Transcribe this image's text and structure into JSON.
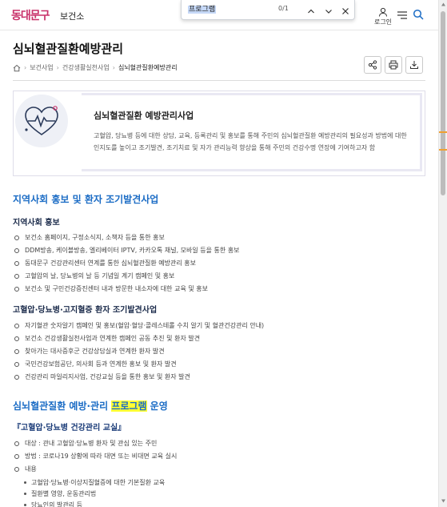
{
  "header": {
    "logo": "동대문구",
    "site_name": "보건소",
    "login_label": "로그인"
  },
  "findbar": {
    "query": "프로그램",
    "count": "0/1"
  },
  "page": {
    "title": "심뇌혈관질환예방관리",
    "breadcrumb": [
      "보건사업",
      "건강생활실천사업",
      "심뇌혈관질환예방관리"
    ]
  },
  "intro": {
    "title": "심뇌혈관질환 예방관리사업",
    "text": "고혈압, 당뇨병 등에 대한 상담, 교육, 등록관리 및 홍보를 통해 주민의 심뇌혈관질환 예방관리의 필요성과 방법에 대한 인지도를 높이고 조기발견, 조기치료 및 자가 관리능력 향상을 통해 주민의 건강수명 연장에 기여하고자 함"
  },
  "section1": {
    "title": "지역사회 홍보 및 환자 조기발견사업",
    "sub1": {
      "title": "지역사회 홍보",
      "items": [
        "보건소 홈페이지, 구정소식지, 소책자 등을 통한 홍보",
        "DDM방송, 케이블방송, 엘리베이터 IPTV, 카카오톡 채널, 모바일 등을 통한 홍보",
        "동대문구 건강관리센터 연계를 통한 심뇌혈관질환 예방관리 홍보",
        "고혈압의 날, 당뇨병의 날 등 기념일 계기 캠페인 및 홍보",
        "보건소 및 구민건강증진센터 내과 방문한 내소자에 대한 교육 및 홍보"
      ]
    },
    "sub2": {
      "title": "고혈압·당뇨병·고지혈증 환자 조기발견사업",
      "items": [
        "자기혈관 숫자알기 캠페인 및 홍보(혈압·혈당·콜레스테롤 수치 알기 및 혈관건강관리 안내)",
        "보건소 건강생활실천사업과 연계한 캠페인 공동 추진 및 환자 발견",
        "찾아가는 대사증후군 건강상담실과 연계한 환자 발견",
        "국민건강보험공단, 의사회 등과 연계한 홍보 및 환자 발견",
        "건강관리 마일리지사업, 건강교실 등을 통한 홍보 및 환자 발견"
      ]
    }
  },
  "section2": {
    "title_before": "심뇌혈관질환 예방·관리 ",
    "title_highlight": "프로그램",
    "title_after": " 운영",
    "sub_title": "『고혈압·당뇨병 건강관리 교실』",
    "items": [
      "대상 : 관내 고혈압·당뇨병 환자 및 관심 있는 주민",
      "방법 : 코로나19 상황에 따라 대면 또는 비대면 교육 실시",
      "내용"
    ],
    "content_items": [
      "고혈압·당뇨병·이상지질혈증에 대한 기본질환 교육",
      "질환별 영양, 운동관리법",
      "당뇨인의 발관리 등"
    ]
  },
  "colors": {
    "accent_blue": "#1b6cc5",
    "logo_pink": "#c8326a",
    "highlight": "#ffff33"
  }
}
